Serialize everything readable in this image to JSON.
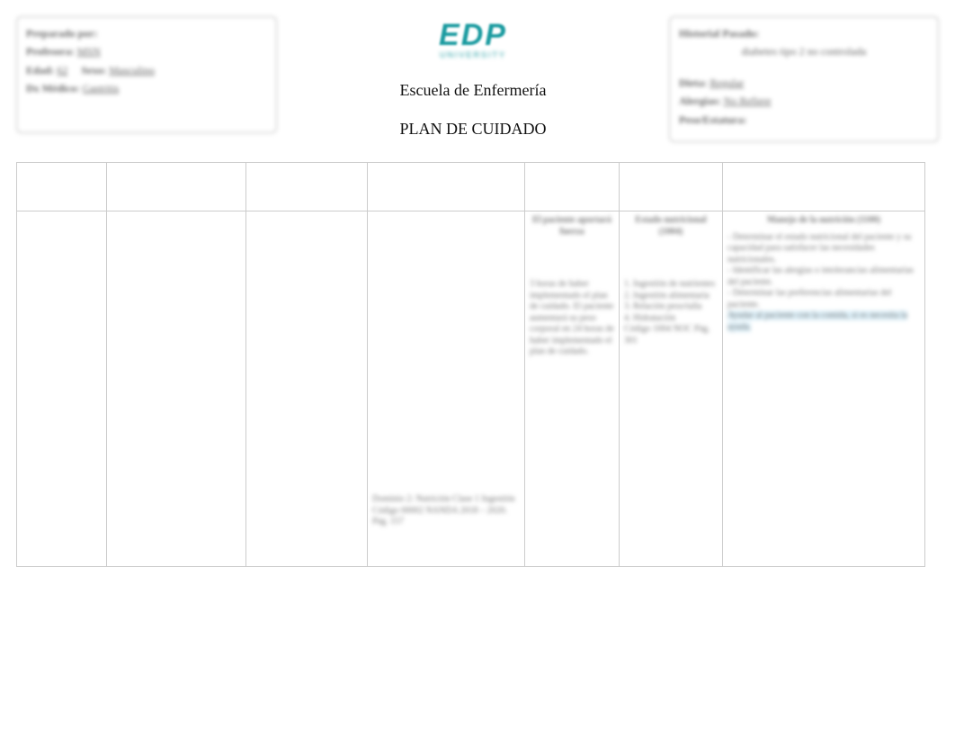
{
  "logo": {
    "main": "EDP",
    "sub": "UNIVERSITY"
  },
  "center": {
    "school": "Escuela de Enfermería",
    "title": "PLAN DE CUIDADO"
  },
  "left_box": {
    "line1_k": "Preparado por:",
    "line2_k": "Profesora:",
    "line2_v": "MSN",
    "line3_ak": "Edad:",
    "line3_av": "62",
    "line3_bk": "Sexo:",
    "line3_bv": "Masculino",
    "line4_k": "Dx Médico:",
    "line4_v": "Gastritis"
  },
  "right_box": {
    "line1_k": "Historial Pasado:",
    "line1_v": "diabetes tipo 2 no controlada",
    "line2_k": "Dieta:",
    "line2_v": "Regular",
    "line3_k": "Alergias:",
    "line3_v": "No Refiere",
    "line4_k": "Peso/Estatura:"
  },
  "table": {
    "headers": [
      "",
      "",
      "",
      "",
      "",
      "",
      ""
    ],
    "row": {
      "c0": "",
      "c1": "",
      "c2": "",
      "c3_body": "Dominio 2: Nutrición Clase 1 Ingestión Código 00002 NANDA 2018 – 2020. Pág. 157",
      "c4_title": "El paciente aportará fuerza",
      "c4_body": "3 horas de haber implementado el plan de cuidado. El paciente aumentará su peso corporal en 24 horas de haber implementado el plan de cuidado.",
      "c5_title": "Estado nutricional (1004)",
      "c5_body": "1. Ingestión de nutrientes\n2. Ingestión alimentaria\n3. Relación peso/talla\n4. Hidratación\nCódigo 1004 NOC Pág. 301",
      "c6_title": "Manejo de la nutrición (1100)",
      "c6_bullets": "- Determinar el estado nutricional del paciente y su capacidad para satisfacer las necesidades nutricionales.\n- Identificar las alergias o intolerancias alimentarias del paciente.\n- Determinar las preferencias alimentarias del paciente.",
      "c6_hl": "Ayudar al paciente con la comida, si es necesita la ayuda."
    }
  }
}
